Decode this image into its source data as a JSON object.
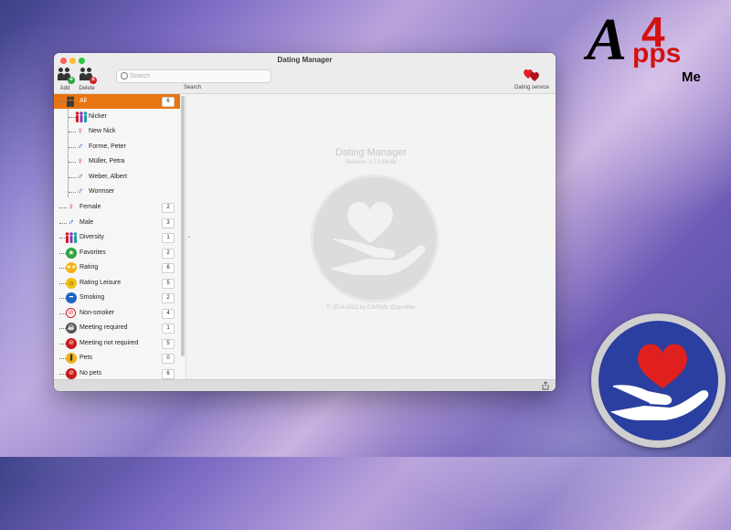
{
  "logo": {
    "a": "A",
    "four": "4",
    "pps": "pps",
    "me": "Me"
  },
  "window": {
    "title": "Dating Manager"
  },
  "toolbar": {
    "add_label": "Add",
    "delete_label": "Delete",
    "search_placeholder": "Search",
    "search_caption": "Search",
    "dating_service_label": "Dating service"
  },
  "sidebar": {
    "all": {
      "label": "All",
      "count": "6"
    },
    "persons": [
      {
        "label": "Nicker",
        "gender": "diversity"
      },
      {
        "label": "New Nick",
        "gender": "female"
      },
      {
        "label": "Forme, Peter",
        "gender": "male"
      },
      {
        "label": "Müller, Petra",
        "gender": "female"
      },
      {
        "label": "Weber, Albert",
        "gender": "male"
      },
      {
        "label": "Wormser",
        "gender": "male"
      }
    ],
    "categories": [
      {
        "label": "Female",
        "count": "2",
        "icon": "female-icon"
      },
      {
        "label": "Male",
        "count": "3",
        "icon": "male-icon"
      },
      {
        "label": "Diversity",
        "count": "1",
        "icon": "diversity-icon"
      },
      {
        "label": "Favorites",
        "count": "2",
        "icon": "favorites-star-icon"
      },
      {
        "label": "Rating",
        "count": "6",
        "icon": "rating-icon"
      },
      {
        "label": "Rating Leisure",
        "count": "5",
        "icon": "rating-leisure-icon"
      },
      {
        "label": "Smoking",
        "count": "2",
        "icon": "smoking-icon"
      },
      {
        "label": "Non-smoker",
        "count": "4",
        "icon": "non-smoker-icon"
      },
      {
        "label": "Meeting required",
        "count": "1",
        "icon": "meeting-required-icon"
      },
      {
        "label": "Meeting not required",
        "count": "5",
        "icon": "meeting-not-required-icon"
      },
      {
        "label": "Pets",
        "count": "0",
        "icon": "pets-icon"
      },
      {
        "label": "No pets",
        "count": "6",
        "icon": "no-pets-icon"
      }
    ]
  },
  "main": {
    "app_name": "Dating Manager",
    "release": "Release: 1.7.0  64 Bit",
    "copyright": "© 2014-2022 by CIMSoft, @pps4Me"
  },
  "colors": {
    "selection": "#e87511",
    "male": "#1e63c4",
    "female": "#d21b2a",
    "heart": "#e0201e",
    "emblem_blue": "#2a3fa0"
  }
}
